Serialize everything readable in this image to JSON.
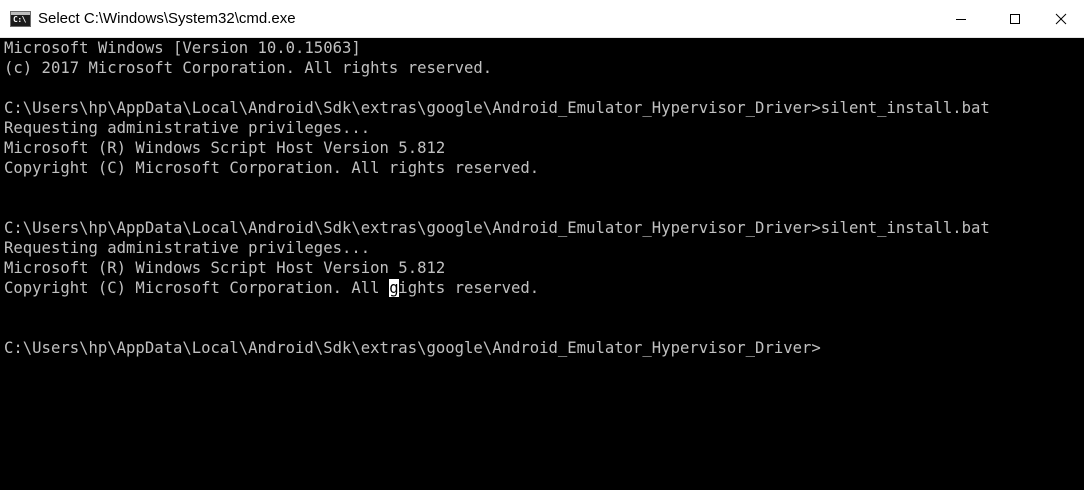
{
  "window": {
    "title": "Select C:\\Windows\\System32\\cmd.exe",
    "icon_text": "C:\\"
  },
  "console": {
    "lines": [
      "Microsoft Windows [Version 10.0.15063]",
      "(c) 2017 Microsoft Corporation. All rights reserved.",
      "",
      "C:\\Users\\hp\\AppData\\Local\\Android\\Sdk\\extras\\google\\Android_Emulator_Hypervisor_Driver>silent_install.bat",
      "Requesting administrative privileges...",
      "Microsoft (R) Windows Script Host Version 5.812",
      "Copyright (C) Microsoft Corporation. All rights reserved.",
      "",
      "",
      "C:\\Users\\hp\\AppData\\Local\\Android\\Sdk\\extras\\google\\Android_Emulator_Hypervisor_Driver>silent_install.bat",
      "Requesting administrative privileges...",
      "Microsoft (R) Windows Script Host Version 5.812",
      "Copyright (C) Microsoft Corporation. All rights reserved.",
      "",
      "",
      "C:\\Users\\hp\\AppData\\Local\\Android\\Sdk\\extras\\google\\Android_Emulator_Hypervisor_Driver>"
    ],
    "selected_char": "g"
  },
  "colors": {
    "console_bg": "#000000",
    "console_text": "#c0c0c0",
    "titlebar_bg": "#ffffff"
  },
  "icons": {
    "minimize": "minimize-icon",
    "maximize": "maximize-icon",
    "close": "close-icon",
    "app": "cmd-app-icon"
  }
}
